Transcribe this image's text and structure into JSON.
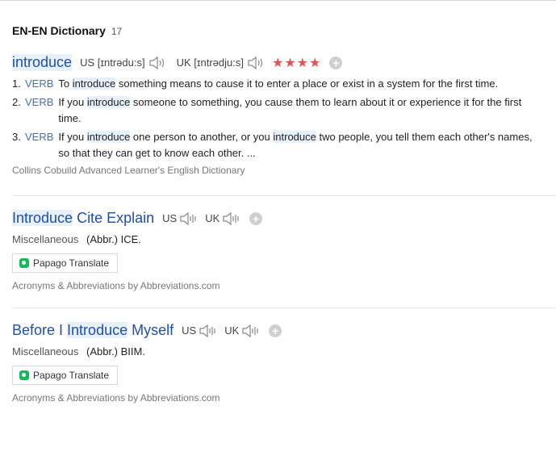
{
  "header": {
    "title": "EN-EN Dictionary",
    "count": "17"
  },
  "entries": [
    {
      "word": "introduce",
      "us_label": "US",
      "us_phonetic": "[ɪntrədu:s]",
      "uk_label": "UK",
      "uk_phonetic": "[ɪntrədju:s]",
      "stars": "★★★★",
      "definitions": [
        {
          "num": "1.",
          "pos": "VERB",
          "before": "To ",
          "term": "introduce",
          "after": " something means to cause it to enter a place or exist in a system for the first time."
        },
        {
          "num": "2.",
          "pos": "VERB",
          "before": "If you ",
          "term": "introduce",
          "after": " someone to something, you cause them to learn about it or experience it for the first time."
        },
        {
          "num": "3.",
          "pos": "VERB",
          "before": "If you ",
          "term": "introduce",
          "mid": " one person to another, or you ",
          "term2": "introduce",
          "after": " two people, you tell them each other's names, so that they can get to know each other. ..."
        }
      ],
      "source": "Collins Cobuild Advanced Learner's English Dictionary"
    },
    {
      "word_a": "Introduce",
      "word_b": " Cite Explain",
      "us_label": "US",
      "uk_label": "UK",
      "category": "Miscellaneous",
      "abbr": "(Abbr.) ICE.",
      "translate": "Papago Translate",
      "source": "Acronyms & Abbreviations by Abbreviations.com"
    },
    {
      "word_pre": "Before I ",
      "word_a": "Introduce",
      "word_b": " Myself",
      "us_label": "US",
      "uk_label": "UK",
      "category": "Miscellaneous",
      "abbr": "(Abbr.) BIIM.",
      "translate": "Papago Translate",
      "source": "Acronyms & Abbreviations by Abbreviations.com"
    }
  ],
  "icons": {
    "speaker_active": "speaker-icon",
    "speaker_wave": "sound-wave-icon",
    "add": "plus-circle-icon"
  },
  "colors": {
    "link": "#1f4fa6",
    "highlight": "#e6f1fb",
    "stars": "#e05454",
    "papago": "#19b55f"
  }
}
